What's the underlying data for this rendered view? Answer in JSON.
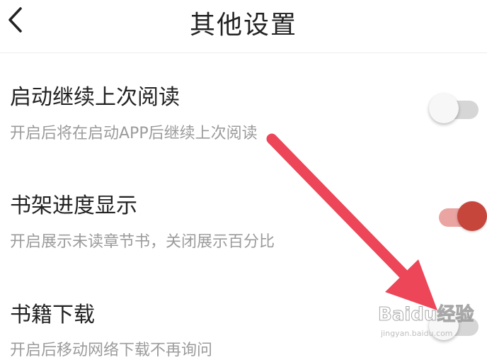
{
  "header": {
    "title": "其他设置",
    "back_icon": "chevron-left-icon"
  },
  "settings": [
    {
      "title": "启动继续上次阅读",
      "description": "开启后将在启动APP后继续上次阅读",
      "enabled": false
    },
    {
      "title": "书架进度显示",
      "description": "开启展示未读章节书，关闭展示百分比",
      "enabled": true
    },
    {
      "title": "书籍下载",
      "description": "开启后移动网络下载不再询问",
      "enabled": false
    }
  ],
  "colors": {
    "toggle_on_knob": "#c6463b",
    "toggle_on_track": "#eaa4a2",
    "toggle_off_track": "#d6d6d6",
    "annotation_arrow": "#ec4658"
  },
  "watermark": {
    "brand": "Baidu经验",
    "url": "jingyan.baidu.com"
  }
}
